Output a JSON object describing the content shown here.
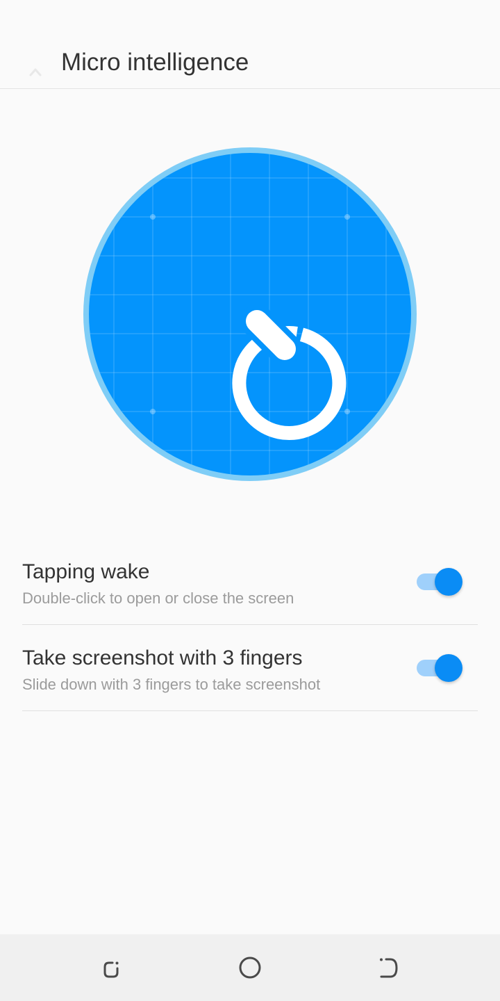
{
  "header": {
    "title": "Micro intelligence",
    "back_icon": "back-arrow-icon"
  },
  "hero": {
    "icon": "quick-search-q-icon",
    "circle_color": "#0494fc",
    "ring_color": "#7fcdf6"
  },
  "settings": [
    {
      "title": "Tapping wake",
      "subtitle": "Double-click to open or close the screen",
      "enabled": true
    },
    {
      "title": "Take screenshot with 3 fingers",
      "subtitle": "Slide down with 3 fingers to take screenshot",
      "enabled": true
    }
  ],
  "colors": {
    "accent": "#0a8cf5",
    "track_on": "#9fd0fb",
    "background": "#fafafa"
  },
  "navbar": {
    "recents_icon": "recents-icon",
    "home_icon": "home-circle-icon",
    "back_icon": "back-icon"
  }
}
